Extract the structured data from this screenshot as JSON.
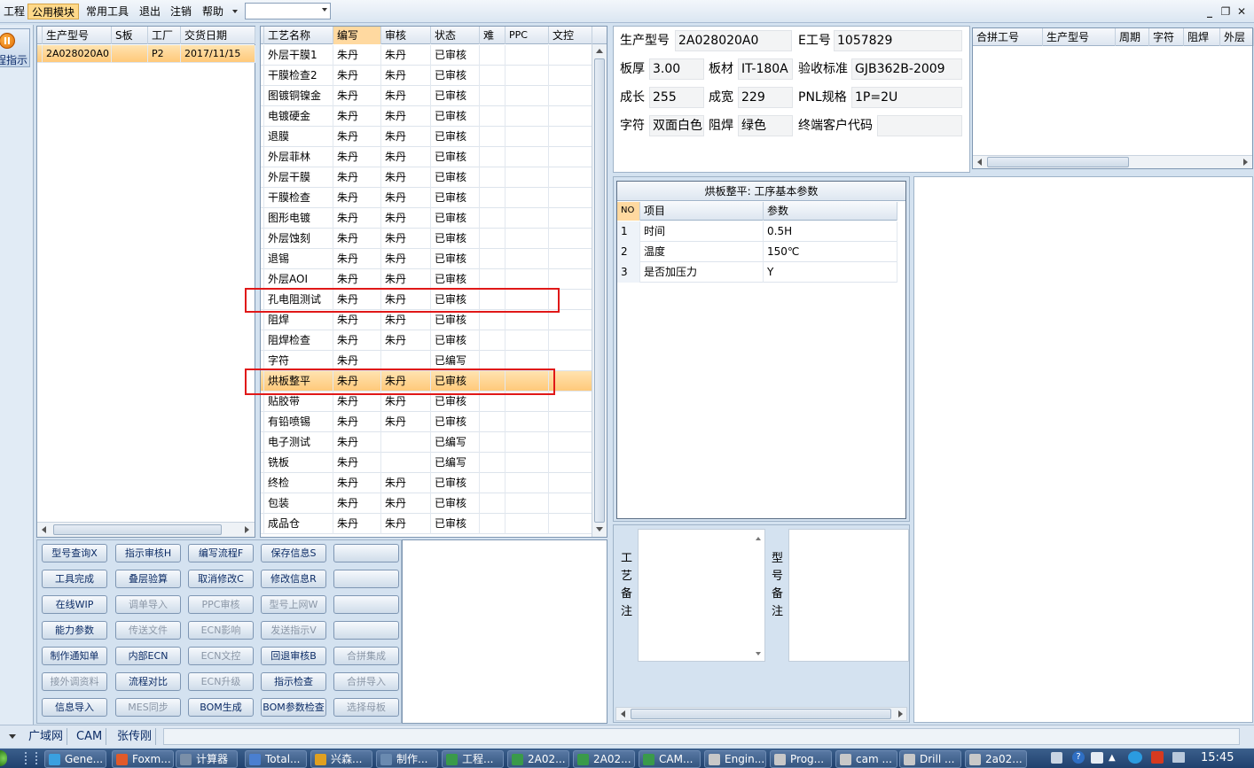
{
  "menubar": {
    "items": [
      "工程",
      "公用模块",
      "常用工具",
      "退出",
      "注销",
      "帮助"
    ],
    "active_index": 1,
    "combo_value": "",
    "window_controls": [
      "minimize",
      "restore",
      "close"
    ]
  },
  "nav": {
    "label": "程指示",
    "icon": "orange-power-icon"
  },
  "model_grid": {
    "headers": [
      "生产型号",
      "S板",
      "工厂",
      "交货日期"
    ],
    "rows": [
      [
        "2A028020A0",
        "",
        "P2",
        "2017/11/15"
      ]
    ]
  },
  "process_grid": {
    "headers": [
      "工艺名称",
      "编写",
      "审核",
      "状态",
      "难",
      "PPC",
      "文控"
    ],
    "highlight_header_index": 1,
    "selected_row_index": 16,
    "boxed_row_indices": [
      12,
      16
    ],
    "rows": [
      [
        "外层干膜1",
        "朱丹",
        "朱丹",
        "已审核"
      ],
      [
        "干膜检查2",
        "朱丹",
        "朱丹",
        "已审核"
      ],
      [
        "图镀铜镍金",
        "朱丹",
        "朱丹",
        "已审核"
      ],
      [
        "电镀硬金",
        "朱丹",
        "朱丹",
        "已审核"
      ],
      [
        "退膜",
        "朱丹",
        "朱丹",
        "已审核"
      ],
      [
        "外层菲林",
        "朱丹",
        "朱丹",
        "已审核"
      ],
      [
        "外层干膜",
        "朱丹",
        "朱丹",
        "已审核"
      ],
      [
        "干膜检查",
        "朱丹",
        "朱丹",
        "已审核"
      ],
      [
        "图形电镀",
        "朱丹",
        "朱丹",
        "已审核"
      ],
      [
        "外层蚀刻",
        "朱丹",
        "朱丹",
        "已审核"
      ],
      [
        "退锡",
        "朱丹",
        "朱丹",
        "已审核"
      ],
      [
        "外层AOI",
        "朱丹",
        "朱丹",
        "已审核"
      ],
      [
        "孔电阻测试",
        "朱丹",
        "朱丹",
        "已审核"
      ],
      [
        "阻焊",
        "朱丹",
        "朱丹",
        "已审核"
      ],
      [
        "阻焊检查",
        "朱丹",
        "朱丹",
        "已审核"
      ],
      [
        "字符",
        "朱丹",
        "",
        "已编写"
      ],
      [
        "烘板整平",
        "朱丹",
        "朱丹",
        "已审核"
      ],
      [
        "贴胶带",
        "朱丹",
        "朱丹",
        "已审核"
      ],
      [
        "有铅喷锡",
        "朱丹",
        "朱丹",
        "已审核"
      ],
      [
        "电子测试",
        "朱丹",
        "",
        "已编写"
      ],
      [
        "铣板",
        "朱丹",
        "",
        "已编写"
      ],
      [
        "终检",
        "朱丹",
        "朱丹",
        "已审核"
      ],
      [
        "包装",
        "朱丹",
        "朱丹",
        "已审核"
      ],
      [
        "成品仓",
        "朱丹",
        "朱丹",
        "已审核"
      ]
    ]
  },
  "buttons": [
    [
      "型号查询X",
      "指示审核H",
      "编写流程F",
      "保存信息S",
      ""
    ],
    [
      "工具完成",
      "叠层验算",
      "取消修改C",
      "修改信息R",
      ""
    ],
    [
      "在线WIP",
      "调单导入",
      "PPC审核",
      "型号上网W",
      ""
    ],
    [
      "能力参数",
      "传送文件",
      "ECN影响",
      "发送指示V",
      ""
    ],
    [
      "制作通知单",
      "内部ECN",
      "ECN文控",
      "回退审核B",
      "合拼集成"
    ],
    [
      "接外调资料",
      "流程对比",
      "ECN升级",
      "指示检查",
      "合拼导入"
    ],
    [
      "信息导入",
      "MES同步",
      "BOM生成",
      "BOM参数检查",
      "选择母板"
    ]
  ],
  "disabled_buttons": [
    "调单导入",
    "PPC审核",
    "型号上网W",
    "传送文件",
    "ECN影响",
    "发送指示V",
    "ECN文控",
    "合拼集成",
    "接外调资料",
    "ECN升级",
    "合拼导入",
    "MES同步",
    "选择母板"
  ],
  "info": {
    "model_label": "生产型号",
    "model_value": "2A028020A0",
    "e_label": "E工号",
    "e_value": "1057829",
    "thickness_label": "板厚",
    "thickness_value": "3.00",
    "material_label": "板材",
    "material_value": "IT-180A",
    "standard_label": "验收标准",
    "standard_value": "GJB362B-2009",
    "length_label": "成长",
    "length_value": "255",
    "width_label": "成宽",
    "width_value": "229",
    "pnl_label": "PNL规格",
    "pnl_value": "1P=2U",
    "char_label": "字符",
    "char_value": "双面白色",
    "mask_label": "阻焊",
    "mask_value": "绿色",
    "customer_label": "终端客户代码",
    "customer_value": ""
  },
  "merge_grid": {
    "headers": [
      "合拼工号",
      "生产型号",
      "周期",
      "字符",
      "阻焊",
      "外层"
    ]
  },
  "params": {
    "title": "烘板整平: 工序基本参数",
    "headers": [
      "NO",
      "项目",
      "参数"
    ],
    "rows": [
      [
        "1",
        "时间",
        "0.5H"
      ],
      [
        "2",
        "温度",
        "150℃"
      ],
      [
        "3",
        "是否加压力",
        "Y"
      ]
    ]
  },
  "notes": {
    "process_label": "工艺备注",
    "model_label": "型号备注",
    "process_text": "",
    "model_text": ""
  },
  "status": {
    "items": [
      "广域网",
      "CAM",
      "张传刚"
    ]
  },
  "taskbar": {
    "items": [
      "Gene...",
      "Foxm...",
      "计算器",
      "Total...",
      "兴森...",
      "制作...",
      "工程...",
      "2A02...",
      "2A02...",
      "CAM...",
      "Engin...",
      "Prog...",
      "cam ...",
      "Drill ...",
      "2a02..."
    ],
    "time": "15:45"
  },
  "colors": {
    "accent": "#ffd98a",
    "selected_row": "#ffc97a",
    "red_box": "#e01818",
    "panel_bg": "#d4e2f0"
  }
}
